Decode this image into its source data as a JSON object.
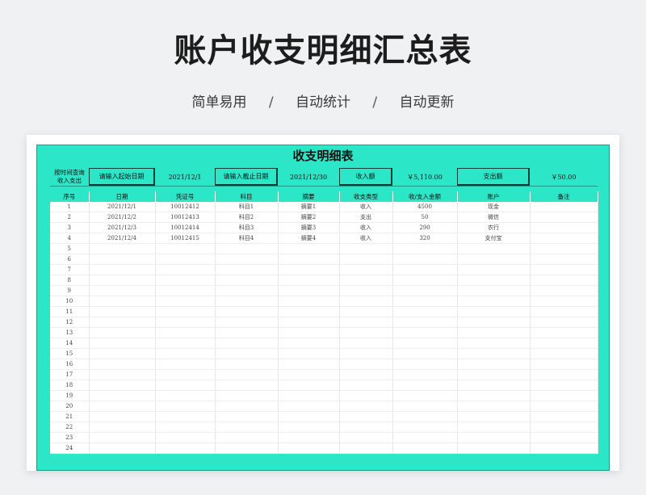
{
  "page": {
    "title": "账户收支明细汇总表",
    "features": [
      "简单易用",
      "自动统计",
      "自动更新"
    ],
    "separator": "/"
  },
  "sheet": {
    "title": "收支明细表",
    "query": {
      "label_line1": "按时间查询",
      "label_line2": "收入支出",
      "start_button": "请输入起始日期",
      "start_date": "2021/12/1",
      "end_button": "请输入截止日期",
      "end_date": "2021/12/30",
      "income_label": "收入额",
      "income_value": "￥5,110.00",
      "expense_label": "支出额",
      "expense_value": "￥50.00"
    },
    "columns": [
      "序号",
      "日期",
      "凭证号",
      "科目",
      "摘要",
      "收支类型",
      "收/支入金额",
      "账户",
      "备注"
    ],
    "rows": [
      [
        "1",
        "2021/12/1",
        "10012412",
        "科目1",
        "摘要1",
        "收入",
        "4500",
        "现金",
        ""
      ],
      [
        "2",
        "2021/12/2",
        "10012413",
        "科目2",
        "摘要2",
        "支出",
        "50",
        "微信",
        ""
      ],
      [
        "3",
        "2021/12/3",
        "10012414",
        "科目3",
        "摘要3",
        "收入",
        "290",
        "农行",
        ""
      ],
      [
        "4",
        "2021/12/4",
        "10012415",
        "科目4",
        "摘要4",
        "收入",
        "320",
        "支付宝",
        ""
      ],
      [
        "5",
        "",
        "",
        "",
        "",
        "",
        "",
        "",
        ""
      ],
      [
        "6",
        "",
        "",
        "",
        "",
        "",
        "",
        "",
        ""
      ],
      [
        "7",
        "",
        "",
        "",
        "",
        "",
        "",
        "",
        ""
      ],
      [
        "8",
        "",
        "",
        "",
        "",
        "",
        "",
        "",
        ""
      ],
      [
        "9",
        "",
        "",
        "",
        "",
        "",
        "",
        "",
        ""
      ],
      [
        "10",
        "",
        "",
        "",
        "",
        "",
        "",
        "",
        ""
      ],
      [
        "11",
        "",
        "",
        "",
        "",
        "",
        "",
        "",
        ""
      ],
      [
        "12",
        "",
        "",
        "",
        "",
        "",
        "",
        "",
        ""
      ],
      [
        "13",
        "",
        "",
        "",
        "",
        "",
        "",
        "",
        ""
      ],
      [
        "14",
        "",
        "",
        "",
        "",
        "",
        "",
        "",
        ""
      ],
      [
        "15",
        "",
        "",
        "",
        "",
        "",
        "",
        "",
        ""
      ],
      [
        "16",
        "",
        "",
        "",
        "",
        "",
        "",
        "",
        ""
      ],
      [
        "17",
        "",
        "",
        "",
        "",
        "",
        "",
        "",
        ""
      ],
      [
        "18",
        "",
        "",
        "",
        "",
        "",
        "",
        "",
        ""
      ],
      [
        "19",
        "",
        "",
        "",
        "",
        "",
        "",
        "",
        ""
      ],
      [
        "20",
        "",
        "",
        "",
        "",
        "",
        "",
        "",
        ""
      ],
      [
        "21",
        "",
        "",
        "",
        "",
        "",
        "",
        "",
        ""
      ],
      [
        "22",
        "",
        "",
        "",
        "",
        "",
        "",
        "",
        ""
      ],
      [
        "23",
        "",
        "",
        "",
        "",
        "",
        "",
        "",
        ""
      ],
      [
        "24",
        "",
        "",
        "",
        "",
        "",
        "",
        "",
        ""
      ]
    ]
  },
  "colors": {
    "accent": "#2ce6c8",
    "background": "#eff1f3"
  }
}
